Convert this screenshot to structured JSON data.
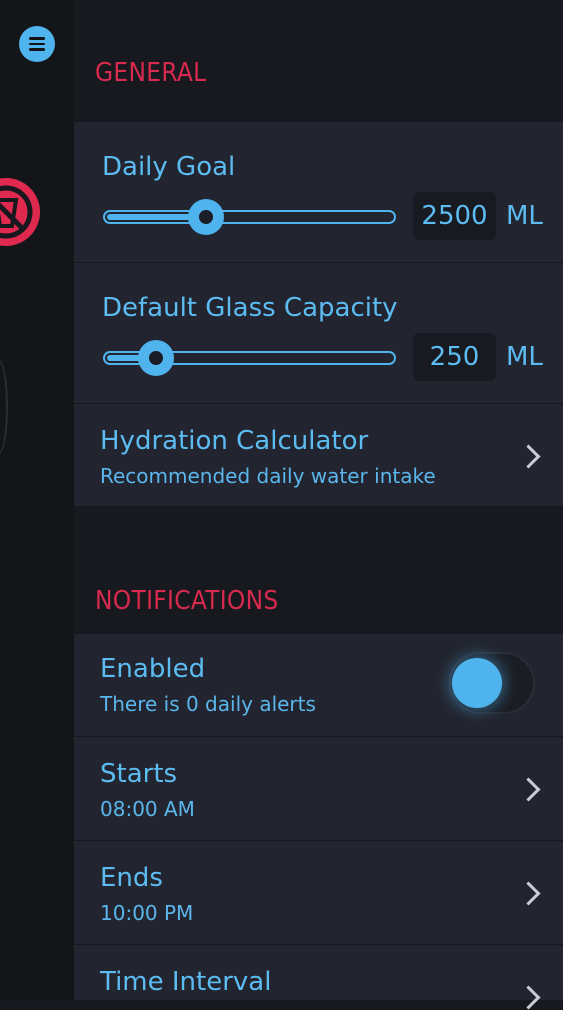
{
  "sidebar": {
    "menu_icon": "hamburger-menu-icon",
    "no_glass_icon": "no-glass-icon"
  },
  "general": {
    "title": "GENERAL",
    "daily_goal": {
      "label": "Daily Goal",
      "value": "2500",
      "unit": "ML",
      "slider_level": 0.35
    },
    "glass_capacity": {
      "label": "Default Glass Capacity",
      "value": "250",
      "unit": "ML",
      "slider_level": 0.18
    },
    "hydration_calculator": {
      "label": "Hydration Calculator",
      "sub": "Recommended daily water intake"
    }
  },
  "notifications": {
    "title": "NOTIFICATIONS",
    "enabled": {
      "label": "Enabled",
      "sub": "There is 0 daily alerts",
      "toggle_on": true
    },
    "starts": {
      "label": "Starts",
      "value": "08:00 AM"
    },
    "ends": {
      "label": "Ends",
      "value": "10:00 PM"
    },
    "interval": {
      "label": "Time Interval"
    }
  },
  "colors": {
    "accent": "#4fb3ee",
    "section_title": "#d8294f",
    "card_bg": "#22252f",
    "page_bg": "#17191f"
  }
}
